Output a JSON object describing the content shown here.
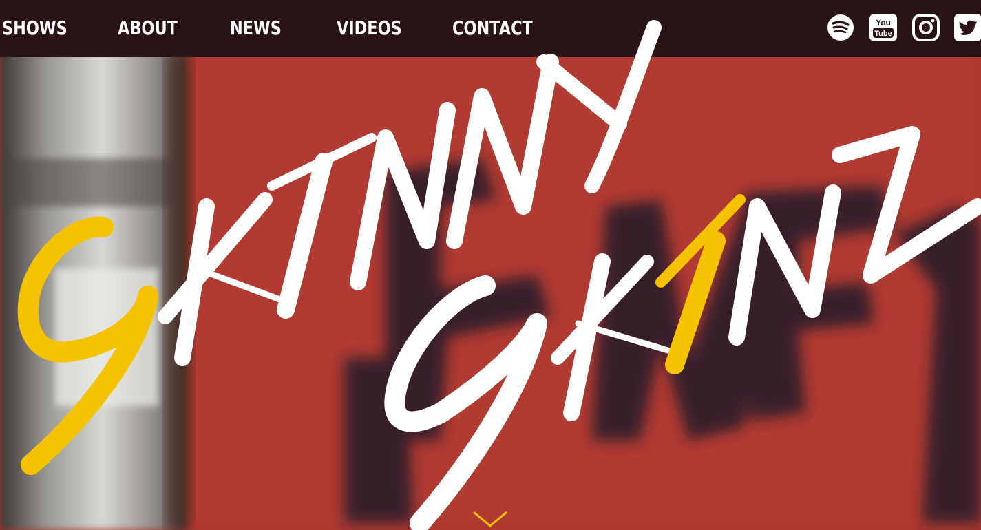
{
  "nav": {
    "items": [
      "SHOWS",
      "ABOUT",
      "NEWS",
      "VIDEOS",
      "CONTACT"
    ]
  },
  "social": [
    {
      "name": "spotify-icon"
    },
    {
      "name": "youtube-icon"
    },
    {
      "name": "instagram-icon"
    },
    {
      "name": "twitter-icon"
    }
  ],
  "logo": {
    "text": "SKINNY SKINZ",
    "icon": "brush-script-logo"
  },
  "colors": {
    "nav_bg": "#2a1314",
    "brick": "#b0322a",
    "accent": "#f6c300",
    "text": "#ffffff"
  },
  "scroll": {
    "icon": "chevron-down-icon"
  }
}
